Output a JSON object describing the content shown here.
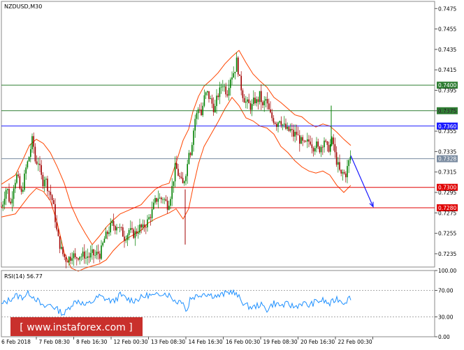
{
  "chart_data": [
    {
      "type": "candlestick",
      "symbol_label": "NZDUSD,M30",
      "ylim": [
        0.7222,
        0.7482
      ],
      "y_ticks": [
        "0.7475",
        "0.7455",
        "0.7435",
        "0.7415",
        "0.7395",
        "0.7375",
        "0.7355",
        "0.7335",
        "0.7315",
        "0.7295",
        "0.7275",
        "0.7255",
        "0.7235"
      ],
      "x_ticks": [
        "6 Feb 2018",
        "7 Feb 08:30",
        "8 Feb 16:30",
        "12 Feb 00:30",
        "13 Feb 08:30",
        "14 Feb 16:30",
        "16 Feb 00:30",
        "19 Feb 08:30",
        "20 Feb 16:30",
        "22 Feb 00:30"
      ],
      "levels": [
        {
          "value": 0.74,
          "label": "0.7400",
          "color": "#2e7d32"
        },
        {
          "value": 0.7375,
          "label": "0.7375",
          "color": "#2e7d32"
        },
        {
          "value": 0.736,
          "label": "0.7360",
          "color": "#1a1aff"
        },
        {
          "value": 0.7328,
          "label": "0.7328",
          "color": "#7a8ba0",
          "kind": "current-price"
        },
        {
          "value": 0.73,
          "label": "0.7300",
          "color": "#e00000"
        },
        {
          "value": 0.728,
          "label": "0.7280",
          "color": "#e00000"
        }
      ],
      "price_path_x": [
        0,
        3,
        5,
        8,
        10,
        13,
        15,
        18,
        22,
        25,
        28,
        31,
        35,
        39,
        44,
        46,
        49,
        52,
        56,
        59,
        61,
        64,
        67,
        71,
        74,
        77,
        80,
        83,
        87,
        90,
        93,
        97,
        100,
        102,
        105,
        108,
        112,
        116,
        118,
        120,
        122,
        126,
        130,
        134,
        138,
        141,
        144,
        147,
        150,
        153,
        156,
        159,
        162,
        166,
        169,
        172,
        176,
        180,
        183,
        186,
        190,
        194,
        198,
        202,
        205,
        208,
        212,
        216,
        219,
        222,
        225,
        228,
        230,
        233,
        235,
        238,
        240,
        243,
        246,
        249,
        252,
        254,
        256,
        258,
        260,
        262,
        264,
        266,
        267,
        268,
        269,
        270,
        272,
        274,
        277,
        280,
        283,
        286,
        290,
        294,
        298,
        302,
        305,
        309,
        313,
        316,
        319,
        323,
        327,
        331,
        334,
        337,
        340,
        343,
        346,
        350,
        354,
        358,
        362,
        366,
        370,
        374,
        378,
        382,
        386,
        390,
        394,
        398,
        402,
        406,
        410,
        414,
        418,
        422,
        426,
        430,
        434,
        438,
        442,
        446,
        450,
        454,
        458,
        462,
        466,
        469,
        472,
        474,
        476,
        478,
        480,
        483,
        486,
        489,
        492,
        495,
        498,
        500
      ],
      "price_path_y": [
        0.7281,
        0.7287,
        0.7295,
        0.7301,
        0.7291,
        0.7283,
        0.7291,
        0.7304,
        0.7311,
        0.7305,
        0.7291,
        0.7302,
        0.7318,
        0.7328,
        0.7346,
        0.7341,
        0.7322,
        0.7328,
        0.7314,
        0.7304,
        0.7311,
        0.7306,
        0.7298,
        0.7292,
        0.7284,
        0.7269,
        0.7253,
        0.7245,
        0.7236,
        0.7232,
        0.7229,
        0.7231,
        0.7232,
        0.7237,
        0.7229,
        0.7232,
        0.7234,
        0.7232,
        0.7237,
        0.7229,
        0.7233,
        0.7232,
        0.7235,
        0.7233,
        0.7236,
        0.7234,
        0.7241,
        0.7249,
        0.7253,
        0.7257,
        0.7261,
        0.7265,
        0.7261,
        0.7264,
        0.7259,
        0.7257,
        0.7251,
        0.7254,
        0.7259,
        0.7255,
        0.7254,
        0.7257,
        0.7261,
        0.7259,
        0.7263,
        0.7265,
        0.7271,
        0.7277,
        0.7285,
        0.7288,
        0.7291,
        0.7287,
        0.7291,
        0.7288,
        0.7286,
        0.7282,
        0.7287,
        0.7295,
        0.7307,
        0.7321,
        0.7315,
        0.7311,
        0.7308,
        0.7304,
        0.7302,
        0.7309,
        0.7315,
        0.7321,
        0.7329,
        0.7335,
        0.7341,
        0.7332,
        0.7341,
        0.7351,
        0.7367,
        0.7372,
        0.7381,
        0.7371,
        0.7387,
        0.7393,
        0.7387,
        0.7381,
        0.7375,
        0.7389,
        0.7395,
        0.7403,
        0.7398,
        0.7392,
        0.7407,
        0.7411,
        0.7415,
        0.7425,
        0.7408,
        0.7398,
        0.7389,
        0.7383,
        0.7381,
        0.7378,
        0.7386,
        0.7383,
        0.7391,
        0.7378,
        0.7387,
        0.7376,
        0.7369,
        0.7366,
        0.7362,
        0.7368,
        0.7362,
        0.7358,
        0.7355,
        0.7356,
        0.7351,
        0.7353,
        0.7347,
        0.7344,
        0.7341,
        0.7344,
        0.7346,
        0.7339,
        0.7343,
        0.7336,
        0.7341,
        0.7347,
        0.7337,
        0.7339,
        0.7343,
        0.7347,
        0.7339,
        0.7329,
        0.7325,
        0.7318,
        0.7311,
        0.7315,
        0.7311,
        0.7319,
        0.7327,
        0.7331
      ],
      "forecast_arrow": {
        "from": [
          500,
          0.7331
        ],
        "to": [
          532,
          0.7281
        ],
        "color": "#1a1aff"
      },
      "ma_color": "#008000",
      "bollinger_color": "#ff4500",
      "upper_band_x": [
        0,
        20,
        30,
        40,
        50,
        60,
        70,
        80,
        90,
        100,
        110,
        120,
        130,
        140,
        150,
        160,
        170,
        180,
        190,
        200,
        210,
        220,
        230,
        240,
        250,
        260,
        268,
        274,
        282,
        290,
        300,
        310,
        320,
        330,
        340,
        350,
        360,
        370,
        380,
        390,
        400,
        410,
        420,
        430,
        440,
        450,
        460,
        470,
        480,
        490,
        500
      ],
      "upper_band_y": [
        0.7303,
        0.7312,
        0.7326,
        0.7341,
        0.7347,
        0.7343,
        0.7334,
        0.732,
        0.7304,
        0.7282,
        0.7267,
        0.7255,
        0.7244,
        0.7252,
        0.7261,
        0.7268,
        0.7274,
        0.7277,
        0.728,
        0.7283,
        0.7291,
        0.7298,
        0.7302,
        0.7304,
        0.7324,
        0.7346,
        0.7357,
        0.7374,
        0.7389,
        0.7399,
        0.7405,
        0.7412,
        0.7421,
        0.7428,
        0.7434,
        0.7422,
        0.7411,
        0.7404,
        0.7398,
        0.7388,
        0.7383,
        0.7377,
        0.7371,
        0.7369,
        0.7363,
        0.7359,
        0.7362,
        0.736,
        0.7354,
        0.7347,
        0.7341
      ],
      "lower_band_x": [
        0,
        20,
        30,
        40,
        50,
        60,
        70,
        80,
        90,
        100,
        110,
        120,
        130,
        140,
        150,
        160,
        170,
        180,
        190,
        200,
        210,
        220,
        230,
        240,
        250,
        260,
        268,
        274,
        282,
        290,
        300,
        310,
        320,
        330,
        340,
        350,
        360,
        370,
        380,
        390,
        400,
        410,
        420,
        430,
        440,
        450,
        460,
        470,
        480,
        490,
        500
      ],
      "lower_band_y": [
        0.7271,
        0.7274,
        0.7283,
        0.7292,
        0.7299,
        0.7296,
        0.7287,
        0.7265,
        0.7236,
        0.7221,
        0.7218,
        0.7221,
        0.7223,
        0.7225,
        0.7229,
        0.7238,
        0.7245,
        0.725,
        0.7254,
        0.7258,
        0.7265,
        0.7269,
        0.7272,
        0.7275,
        0.7279,
        0.7269,
        0.7279,
        0.7299,
        0.7323,
        0.734,
        0.7352,
        0.7364,
        0.7377,
        0.7388,
        0.738,
        0.7368,
        0.7365,
        0.736,
        0.7358,
        0.7352,
        0.734,
        0.7334,
        0.7326,
        0.732,
        0.7316,
        0.7314,
        0.7316,
        0.7312,
        0.7302,
        0.7295,
        0.7302
      ]
    },
    {
      "type": "line",
      "label": "RSI(14) 56.77",
      "ylim": [
        0,
        100
      ],
      "y_ticks": [
        "100.00",
        "70.00",
        "30.00",
        "0.00"
      ],
      "reference_levels": [
        70,
        30
      ],
      "color": "#1e90ff",
      "x": [
        0,
        10,
        20,
        30,
        40,
        50,
        60,
        70,
        80,
        90,
        100,
        110,
        120,
        130,
        140,
        150,
        160,
        170,
        180,
        190,
        200,
        210,
        220,
        230,
        240,
        250,
        260,
        265,
        270,
        280,
        290,
        300,
        310,
        320,
        330,
        340,
        350,
        360,
        370,
        380,
        390,
        400,
        410,
        420,
        430,
        440,
        450,
        460,
        470,
        480,
        490,
        500
      ],
      "values": [
        48,
        55,
        62,
        60,
        66,
        57,
        44,
        49,
        41,
        34,
        49,
        55,
        47,
        53,
        61,
        57,
        53,
        63,
        57,
        55,
        59,
        63,
        61,
        67,
        63,
        53,
        55,
        35,
        58,
        62,
        66,
        63,
        61,
        65,
        69,
        59,
        47,
        44,
        49,
        41,
        51,
        47,
        49,
        45,
        51,
        47,
        53,
        55,
        49,
        58,
        52,
        60
      ]
    }
  ],
  "watermark": "[ www.instaforex.com ]"
}
